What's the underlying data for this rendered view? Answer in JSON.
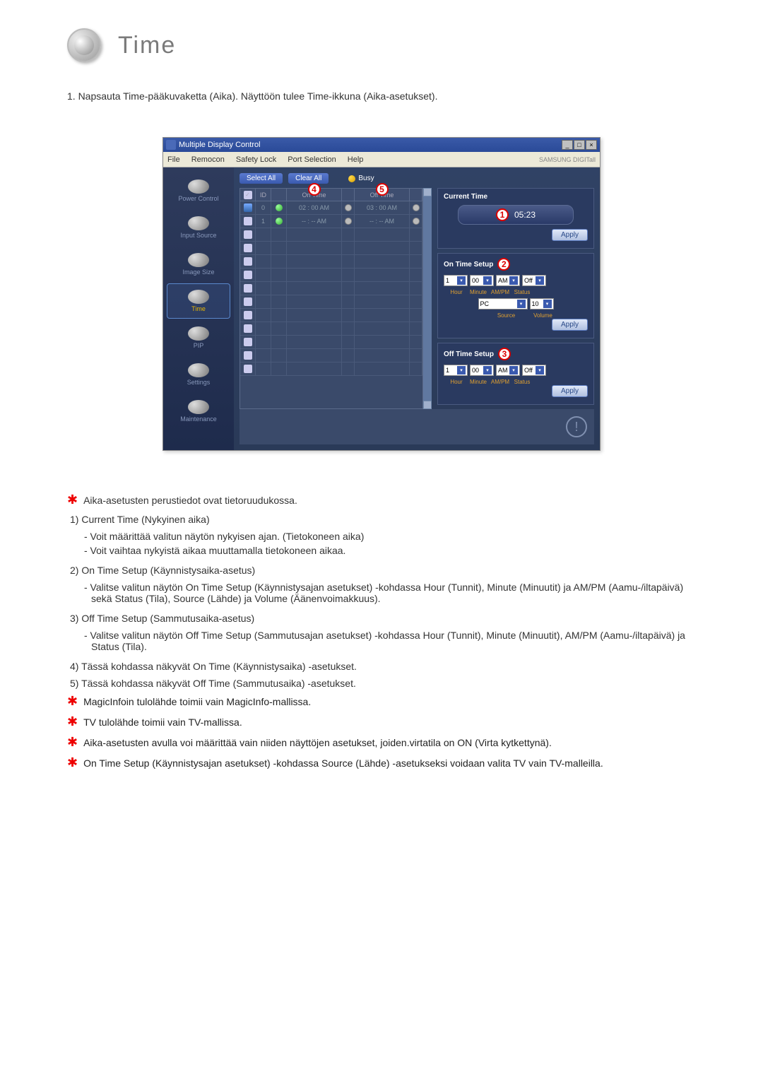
{
  "page": {
    "title": "Time",
    "intro": "1.  Napsauta Time-pääkuvaketta (Aika). Näyttöön tulee Time-ikkuna (Aika-asetukset)."
  },
  "app": {
    "window_title": "Multiple Display Control",
    "brand": "SAMSUNG DIGITall",
    "menu": {
      "file": "File",
      "remocon": "Remocon",
      "safety_lock": "Safety Lock",
      "port_selection": "Port Selection",
      "help": "Help"
    },
    "sidebar": {
      "power": "Power Control",
      "input": "Input Source",
      "image": "Image Size",
      "time": "Time",
      "pip": "PIP",
      "settings": "Settings",
      "maintenance": "Maintenance"
    },
    "top": {
      "select_all": "Select All",
      "clear_all": "Clear All",
      "busy": "Busy"
    },
    "table": {
      "headers": {
        "id": "ID",
        "on_time": "On Time",
        "off_time": "Off Time"
      },
      "callout_on": "4",
      "callout_off": "5",
      "rows": [
        {
          "id": "0",
          "on_time": "02 : 00 AM",
          "off_time": "03 : 00 AM",
          "green": true,
          "check": true
        },
        {
          "id": "1",
          "on_time": "-- : -- AM",
          "off_time": "-- : -- AM",
          "green": true,
          "check": false
        }
      ]
    },
    "panels": {
      "current_time": {
        "title": "Current Time",
        "callout": "1",
        "value": "05:23",
        "apply": "Apply"
      },
      "on_time": {
        "title": "On Time Setup",
        "callout": "2",
        "hour": "1",
        "minute": "00",
        "ampm": "AM",
        "status": "Off",
        "source": "PC",
        "volume": "10",
        "labels": {
          "hour": "Hour",
          "minute": "Minute",
          "ampm": "AM/PM",
          "status": "Status",
          "source": "Source",
          "volume": "Volume"
        },
        "apply": "Apply"
      },
      "off_time": {
        "title": "Off Time Setup",
        "callout": "3",
        "hour": "1",
        "minute": "00",
        "ampm": "AM",
        "status": "Off",
        "labels": {
          "hour": "Hour",
          "minute": "Minute",
          "ampm": "AM/PM",
          "status": "Status"
        },
        "apply": "Apply"
      }
    }
  },
  "desc": {
    "star1": "Aika-asetusten perustiedot ovat tietoruudukossa.",
    "n1_title": "1)  Current Time (Nykyinen aika)",
    "n1_a": "- Voit määrittää valitun näytön nykyisen ajan. (Tietokoneen aika)",
    "n1_b": "- Voit vaihtaa nykyistä aikaa muuttamalla tietokoneen aikaa.",
    "n2_title": "2)  On Time Setup (Käynnistysaika-asetus)",
    "n2_a": "- Valitse valitun näytön On Time Setup (Käynnistysajan asetukset) -kohdassa Hour (Tunnit), Minute (Minuutit) ja AM/PM (Aamu-/iltapäivä) sekä Status (Tila), Source (Lähde) ja Volume (Äänenvoimakkuus).",
    "n3_title": "3)  Off Time Setup (Sammutusaika-asetus)",
    "n3_a": "- Valitse valitun näytön Off Time Setup (Sammutusajan asetukset) -kohdassa Hour (Tunnit), Minute (Minuutit), AM/PM (Aamu-/iltapäivä) ja Status (Tila).",
    "n4": "4)  Tässä kohdassa näkyvät On Time (Käynnistysaika) -asetukset.",
    "n5": "5)  Tässä kohdassa näkyvät Off Time (Sammutusaika) -asetukset.",
    "star2": "MagicInfoin tulolähde toimii vain MagicInfo-mallissa.",
    "star3": "TV tulolähde toimii vain TV-mallissa.",
    "star4": "Aika-asetusten avulla voi määrittää vain niiden näyttöjen asetukset, joiden.virtatila on ON (Virta kytkettynä).",
    "star5": "On Time Setup (Käynnistysajan asetukset) -kohdassa Source (Lähde) -asetukseksi voidaan valita TV vain TV-malleilla."
  }
}
